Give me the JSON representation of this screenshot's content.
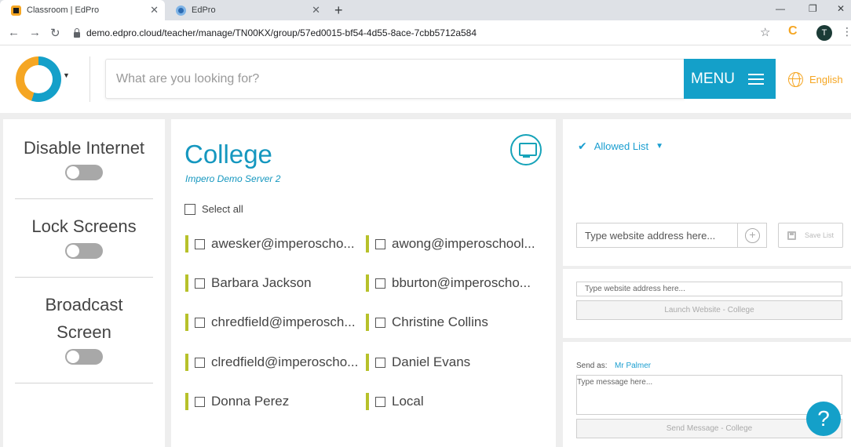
{
  "browser": {
    "tabs": [
      {
        "title": "Classroom | EdPro",
        "icon": "edpro-favicon"
      },
      {
        "title": "EdPro",
        "icon": "chrome-favicon"
      }
    ],
    "url": "demo.edpro.cloud/teacher/manage/TN00KX/group/57ed0015-bf54-4d55-8ace-7cbb5712a584",
    "profile_initial": "T",
    "extension_letter": "C"
  },
  "header": {
    "search_placeholder": "What are you looking for?",
    "menu_label": "MENU",
    "language": "English",
    "accent_color": "#14a0c9",
    "brand_orange": "#f5a623"
  },
  "controls": [
    {
      "label": "Disable Internet",
      "state": "off"
    },
    {
      "label": "Lock Screens",
      "state": "off"
    },
    {
      "label": "Broadcast Screen",
      "label_line1": "Broadcast",
      "label_line2": "Screen",
      "state": "off"
    }
  ],
  "group": {
    "title": "College",
    "server": "Impero Demo Server 2",
    "select_all_label": "Select all",
    "students_left": [
      "awesker@imperoscho...",
      "Barbara Jackson",
      "chredfield@imperosch...",
      "clredfield@imperoscho...",
      "Donna Perez"
    ],
    "students_right": [
      "awong@imperoschool...",
      "bburton@imperoscho...",
      "Christine Collins",
      "Daniel Evans",
      "Local"
    ]
  },
  "allowed_list": {
    "label": "Allowed List",
    "input_placeholder": "Type website address here...",
    "save_label": "Save List"
  },
  "launch": {
    "input_placeholder": "Type website address here...",
    "button_label": "Launch Website - College"
  },
  "message": {
    "send_as_label": "Send as:",
    "sender": "Mr Palmer",
    "placeholder": "Type message here...",
    "button_label": "Send Message - College"
  },
  "help_label": "?"
}
